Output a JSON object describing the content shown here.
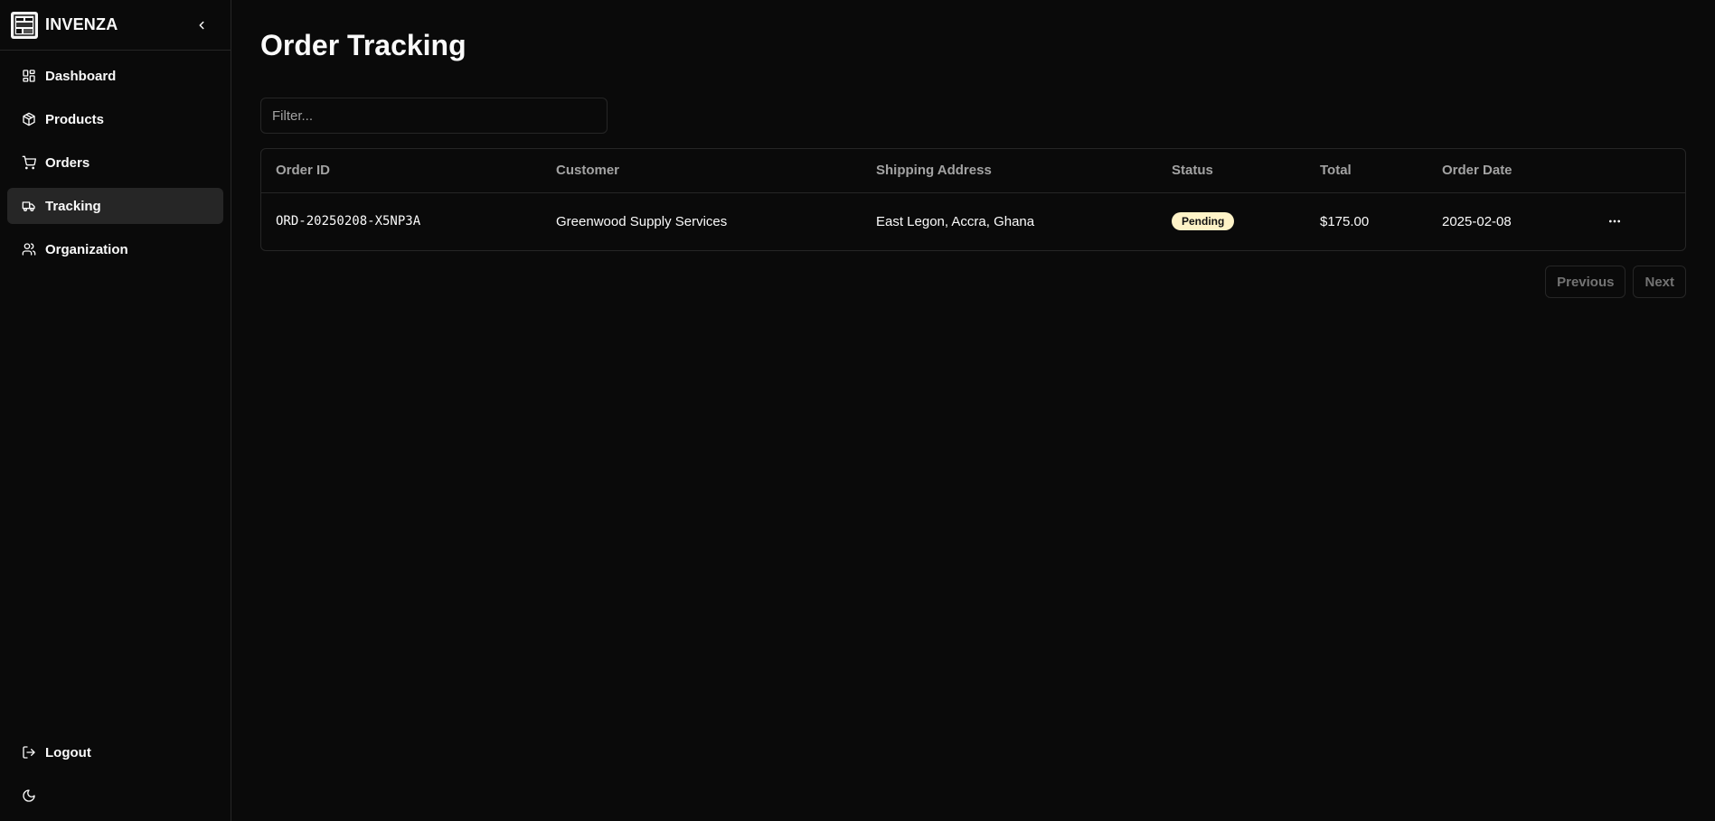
{
  "app": {
    "name": "INVENZA"
  },
  "sidebar": {
    "items": [
      {
        "label": "Dashboard",
        "icon": "dashboard-icon"
      },
      {
        "label": "Products",
        "icon": "package-icon"
      },
      {
        "label": "Orders",
        "icon": "cart-icon"
      },
      {
        "label": "Tracking",
        "icon": "truck-icon",
        "active": true
      },
      {
        "label": "Organization",
        "icon": "users-icon"
      }
    ],
    "logout_label": "Logout"
  },
  "page": {
    "title": "Order Tracking"
  },
  "filter": {
    "placeholder": "Filter..."
  },
  "table": {
    "headers": [
      "Order ID",
      "Customer",
      "Shipping Address",
      "Status",
      "Total",
      "Order Date"
    ],
    "rows": [
      {
        "order_id": "ORD-20250208-X5NP3A",
        "customer": "Greenwood Supply Services",
        "address": "East Legon, Accra, Ghana",
        "status": "Pending",
        "total": "$175.00",
        "date": "2025-02-08"
      }
    ]
  },
  "pagination": {
    "previous": "Previous",
    "next": "Next"
  },
  "colors": {
    "background": "#0a0a0a",
    "border": "#262626",
    "active": "#262626",
    "badge": "#fef3c7"
  }
}
